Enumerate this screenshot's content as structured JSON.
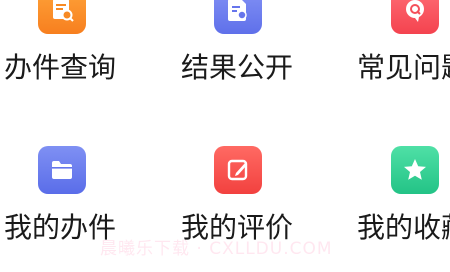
{
  "grid": {
    "items": [
      {
        "label": "办件查询",
        "icon": "document-search-icon",
        "color": "#fb8e2a"
      },
      {
        "label": "结果公开",
        "icon": "document-check-icon",
        "color": "#6f7ff0"
      },
      {
        "label": "常见问题",
        "icon": "question-bubble-icon",
        "color": "#fa5a64"
      },
      {
        "label": "我的办件",
        "icon": "folder-icon",
        "color": "#6a80ef"
      },
      {
        "label": "我的评价",
        "icon": "edit-icon",
        "color": "#f6504f"
      },
      {
        "label": "我的收藏",
        "icon": "star-icon",
        "color": "#33cf95"
      }
    ]
  },
  "watermark": {
    "text": "晨曦乐下载 · CXLLDU.COM"
  }
}
